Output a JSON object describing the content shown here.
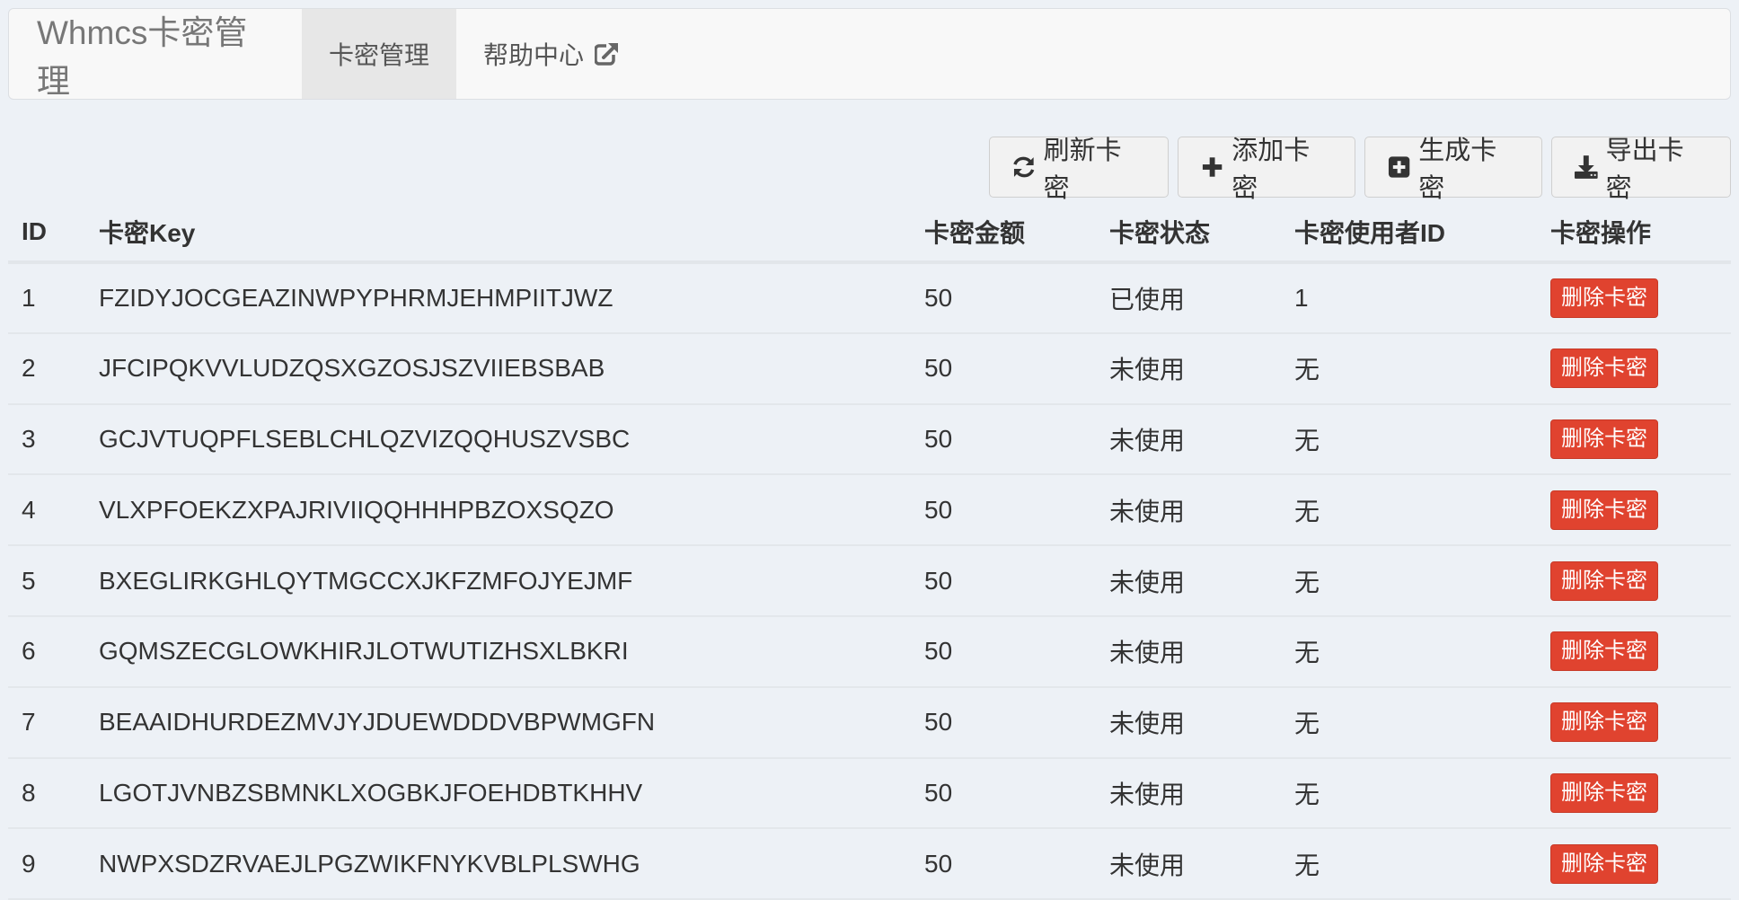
{
  "navbar": {
    "brand": "Whmcs卡密管理",
    "items": [
      {
        "label": "卡密管理",
        "active": true
      },
      {
        "label": "帮助中心",
        "icon": "external-link-icon"
      }
    ]
  },
  "toolbar": {
    "refresh_label": "刷新卡密",
    "add_label": "添加卡密",
    "generate_label": "生成卡密",
    "export_label": "导出卡密"
  },
  "table": {
    "headers": {
      "id": "ID",
      "key": "卡密Key",
      "amount": "卡密金额",
      "status": "卡密状态",
      "user_id": "卡密使用者ID",
      "action": "卡密操作"
    },
    "delete_label": "删除卡密",
    "rows": [
      {
        "id": "1",
        "key": "FZIDYJOCGEAZINWPYPHRMJEHMPIITJWZ",
        "amount": "50",
        "status": "已使用",
        "user_id": "1"
      },
      {
        "id": "2",
        "key": "JFCIPQKVVLUDZQSXGZOSJSZVIIEBSBAB",
        "amount": "50",
        "status": "未使用",
        "user_id": "无"
      },
      {
        "id": "3",
        "key": "GCJVTUQPFLSEBLCHLQZVIZQQHUSZVSBC",
        "amount": "50",
        "status": "未使用",
        "user_id": "无"
      },
      {
        "id": "4",
        "key": "VLXPFOEKZXPAJRIVIIQQHHHPBZOXSQZO",
        "amount": "50",
        "status": "未使用",
        "user_id": "无"
      },
      {
        "id": "5",
        "key": "BXEGLIRKGHLQYTMGCCXJKFZMFOJYEJMF",
        "amount": "50",
        "status": "未使用",
        "user_id": "无"
      },
      {
        "id": "6",
        "key": "GQMSZECGLOWKHIRJLOTWUTIZHSXLBKRI",
        "amount": "50",
        "status": "未使用",
        "user_id": "无"
      },
      {
        "id": "7",
        "key": "BEAAIDHURDEZMVJYJDUEWDDDVBPWMGFN",
        "amount": "50",
        "status": "未使用",
        "user_id": "无"
      },
      {
        "id": "8",
        "key": "LGOTJVNBZSBMNKLXOGBKJFOEHDBTKHHV",
        "amount": "50",
        "status": "未使用",
        "user_id": "无"
      },
      {
        "id": "9",
        "key": "NWPXSDZRVAEJLPGZWIKFNYKVBLPLSWHG",
        "amount": "50",
        "status": "未使用",
        "user_id": "无"
      }
    ]
  },
  "colors": {
    "delete_button": "#e0432f",
    "background": "#edf1f6"
  }
}
